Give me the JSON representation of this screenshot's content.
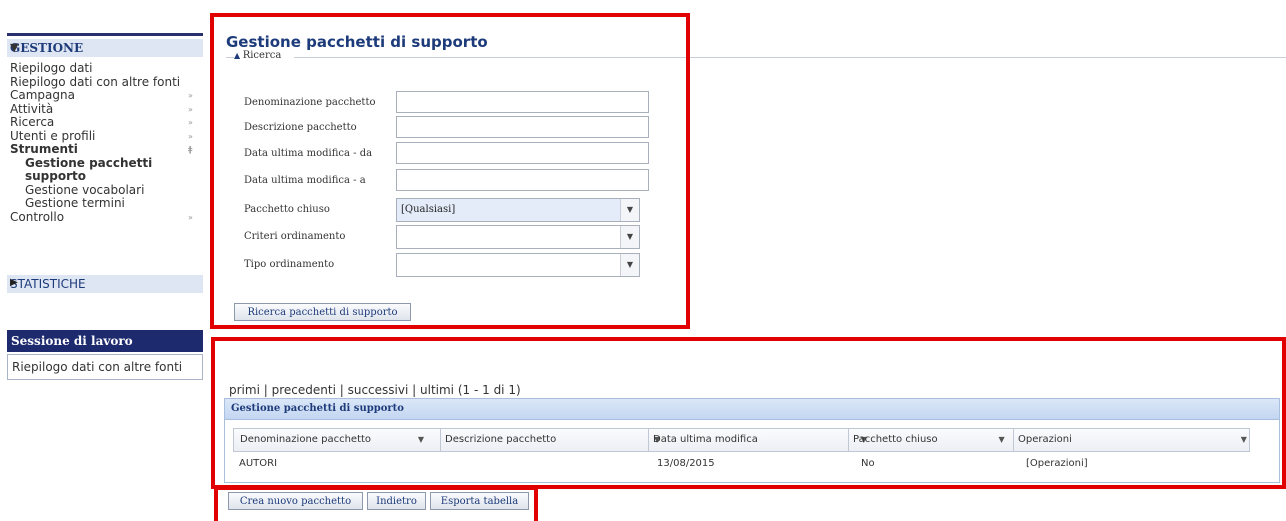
{
  "sidebar": {
    "gestione_header": "GESTIONE",
    "items": [
      {
        "label": "Riepilogo dati"
      },
      {
        "label": "Riepilogo dati con altre fonti"
      },
      {
        "label": "Campagna"
      },
      {
        "label": "Attività"
      },
      {
        "label": "Ricerca"
      },
      {
        "label": "Utenti e profili"
      },
      {
        "label": "Strumenti"
      },
      {
        "label": "Gestione pacchetti"
      },
      {
        "label": "supporto"
      },
      {
        "label": "Gestione vocabolari"
      },
      {
        "label": "Gestione termini"
      },
      {
        "label": "Controllo"
      }
    ],
    "statistiche": "STATISTICHE"
  },
  "session": {
    "title": "Sessione di lavoro",
    "link": "Riepilogo dati con altre fonti"
  },
  "search": {
    "page_title": "Gestione pacchetti di supporto",
    "section_label": "Ricerca",
    "fields": [
      {
        "label": "Denominazione pacchetto",
        "value": ""
      },
      {
        "label": "Descrizione pacchetto",
        "value": ""
      },
      {
        "label": "Data ultima modifica - da",
        "value": ""
      },
      {
        "label": "Data ultima modifica - a",
        "value": ""
      }
    ],
    "selects": [
      {
        "label": "Pacchetto chiuso",
        "value": "[Qualsiasi]"
      },
      {
        "label": "Criteri ordinamento",
        "value": ""
      },
      {
        "label": "Tipo ordinamento",
        "value": ""
      }
    ],
    "search_button": "Ricerca pacchetti di supporto"
  },
  "results": {
    "pager": {
      "first": "primi",
      "prev": "precedenti",
      "next": "successivi",
      "last": "ultimi",
      "range": "(1 - 1 di 1)"
    },
    "grid_title": "Gestione pacchetti di supporto",
    "columns": [
      "Denominazione pacchetto",
      "Descrizione pacchetto",
      "Data ultima modifica",
      "Pacchetto chiuso",
      "Operazioni"
    ],
    "rows": [
      {
        "name": "AUTORI",
        "description": "",
        "date": "13/08/2015",
        "closed": "No",
        "ops": "[Operazioni]"
      }
    ]
  },
  "actions": {
    "new_package": "Crea nuovo pacchetto",
    "back": "Indietro",
    "export": "Esporta tabella"
  },
  "colors": {
    "highlight": "#e00000",
    "sidebar_dark": "#1e2a6e",
    "title_blue": "#1d3b7a"
  }
}
